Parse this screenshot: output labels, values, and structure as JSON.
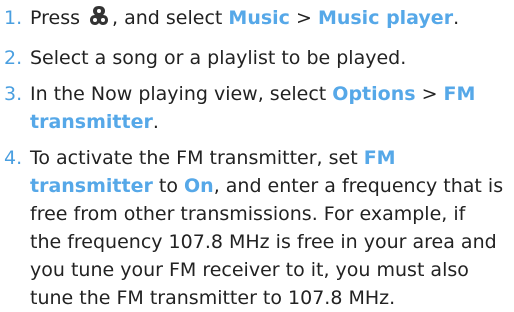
{
  "steps": [
    {
      "number": "1.",
      "before": "Press ",
      "icon": "menu-key-icon",
      "middle": ", and select ",
      "ui1": "Music",
      "sep": " > ",
      "ui2": "Music player",
      "end": "."
    },
    {
      "number": "2.",
      "text": "Select a song or a playlist to be played."
    },
    {
      "number": "3.",
      "before": "In the Now playing view, select ",
      "ui1": "Options",
      "sep": " > ",
      "ui2_line1": "FM",
      "ui2_line2": "transmitter",
      "end": "."
    },
    {
      "number": "4.",
      "before": "To activate the FM transmitter, set ",
      "ui1_line1": "FM",
      "ui1_line2": "transmitter",
      "mid1": " to ",
      "ui2": "On",
      "line2_rest": ", and enter a frequency that is",
      "line3": "free from other transmissions. For example, if",
      "line4": "the frequency 107.8 MHz is free in your area and",
      "line5": "you tune your FM receiver to it, you must also",
      "line6": "tune the FM transmitter to 107.8 MHz."
    }
  ],
  "colors": {
    "text": "#222222",
    "accent": "#56a8e8",
    "number": "#4a9fe0"
  }
}
